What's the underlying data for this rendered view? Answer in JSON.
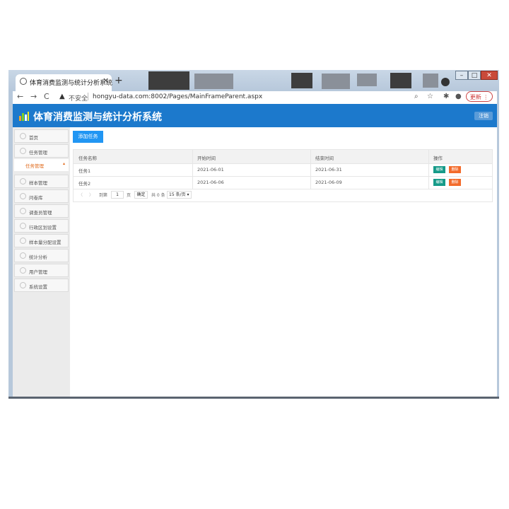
{
  "browser": {
    "tab_title": "体育消费监测与统计分析系统",
    "tab_close": "×",
    "new_tab": "+",
    "back": "←",
    "forward": "→",
    "reload": "C",
    "insecure_label": "不安全",
    "url": "hongyu-data.com:8002/Pages/MainFrameParent.aspx",
    "update_label": "更新",
    "window_controls": {
      "minimize": "–",
      "maximize": "□",
      "close": "✕"
    }
  },
  "app": {
    "title": "体育消费监测与统计分析系统",
    "logout": "注销",
    "header_color": "#1c79cc"
  },
  "sidebar": {
    "items": [
      {
        "label": "首页",
        "icon": "home-icon"
      },
      {
        "label": "任务管理",
        "icon": "task-icon"
      },
      {
        "label": "样本管理",
        "icon": "sample-icon"
      },
      {
        "label": "问卷库",
        "icon": "questionnaire-icon"
      },
      {
        "label": "调查员管理",
        "icon": "surveyor-icon"
      },
      {
        "label": "行政区划设置",
        "icon": "region-icon"
      },
      {
        "label": "样本量分配设置",
        "icon": "allocation-icon"
      },
      {
        "label": "统计分析",
        "icon": "stats-icon"
      },
      {
        "label": "用户管理",
        "icon": "user-icon"
      },
      {
        "label": "系统设置",
        "icon": "settings-icon"
      }
    ],
    "active_sub": {
      "label": "任务管理",
      "arrow": "▴"
    }
  },
  "main": {
    "add_button": "添加任务",
    "table": {
      "headers": [
        "任务名称",
        "开始时间",
        "结束时间",
        "操作"
      ],
      "rows": [
        {
          "name": "任务1",
          "start": "2021-06-01",
          "end": "2021-06-31",
          "edit": "编辑",
          "delete": "删除"
        },
        {
          "name": "任务2",
          "start": "2021-06-06",
          "end": "2021-06-09",
          "edit": "编辑",
          "delete": "删除"
        }
      ]
    },
    "pager": {
      "prev": "〈",
      "next": "〉",
      "goto_label": "到第",
      "page_value": "1",
      "page_unit": "页",
      "confirm": "确定",
      "total": "共 0 条",
      "page_size": "15 条/页"
    }
  }
}
